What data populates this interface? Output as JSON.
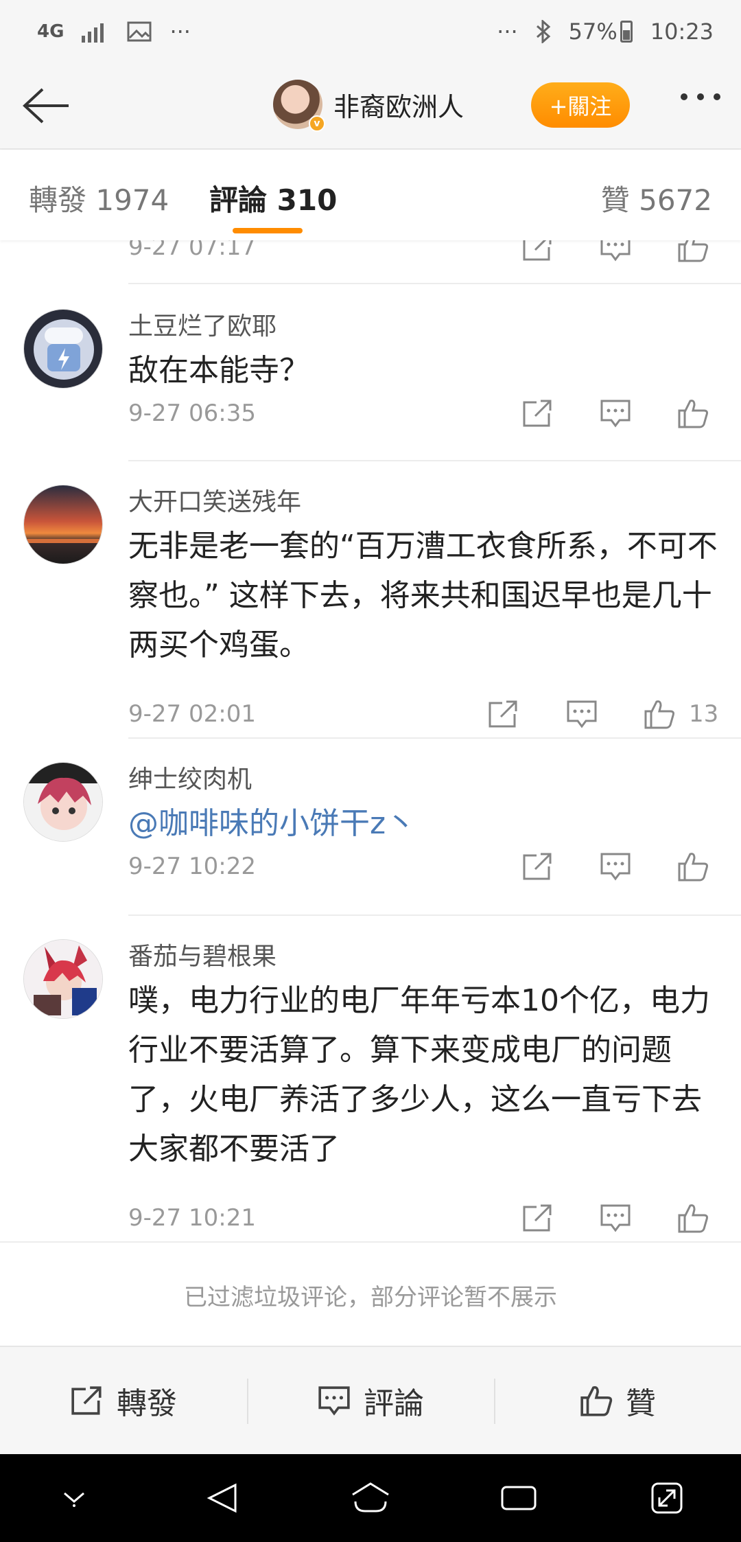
{
  "status_bar": {
    "network": "4G",
    "ellipsis": "···",
    "battery": "57%",
    "time": "10:23"
  },
  "header": {
    "username": "非裔欧洲人",
    "follow_label": "+關注",
    "verified": "v"
  },
  "tabs": [
    {
      "label": "轉發 1974"
    },
    {
      "label": "評論 310"
    },
    {
      "label": "贊 5672"
    }
  ],
  "comments": [
    {
      "date": "9-27 07:17"
    },
    {
      "name": "土豆烂了欧耶",
      "text": "敌在本能寺？",
      "date": "9-27 06:35"
    },
    {
      "name": "大开口笑送残年",
      "text": "无非是老一套的“百万漕工衣食所系，不可不察也。” 这样下去，将来共和国迟早也是几十两买个鸡蛋。",
      "date": "9-27 02:01",
      "likes": "13"
    },
    {
      "name": "绅士绞肉机",
      "text": "@咖啡味的小饼干z丶",
      "date": "9-27 10:22"
    },
    {
      "name": "番茄与碧根果",
      "text": "噗，电力行业的电厂年年亏本10个亿，电力行业不要活算了。算下来变成电厂的问题了，火电厂养活了多少人，这么一直亏下去大家都不要活了",
      "date": "9-27 10:21"
    }
  ],
  "filter_note": "已过滤垃圾评论，部分评论暂不展示",
  "bottom_bar": {
    "repost": "轉發",
    "comment": "評論",
    "like": "贊"
  },
  "colors": {
    "accent": "#ff8c00",
    "mention": "#4a7ab6"
  }
}
